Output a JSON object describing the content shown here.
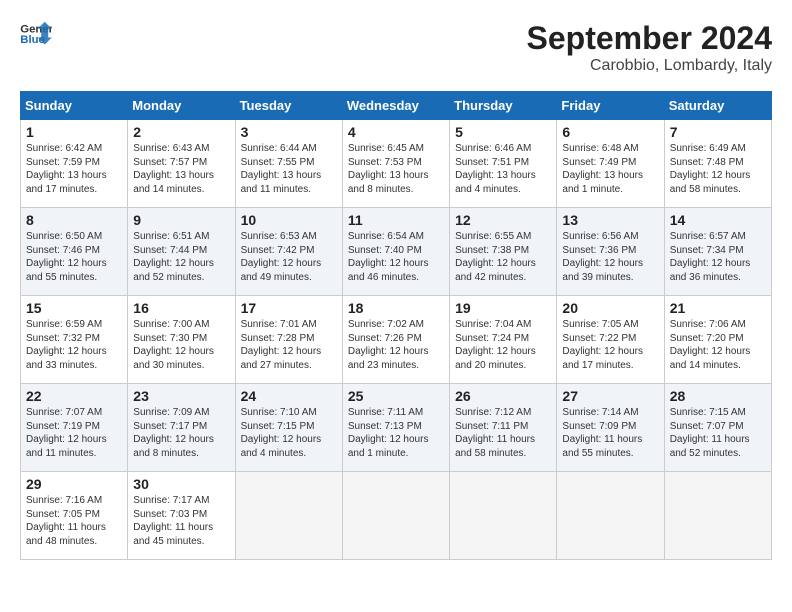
{
  "header": {
    "logo_line1": "General",
    "logo_line2": "Blue",
    "month_year": "September 2024",
    "location": "Carobbio, Lombardy, Italy"
  },
  "weekdays": [
    "Sunday",
    "Monday",
    "Tuesday",
    "Wednesday",
    "Thursday",
    "Friday",
    "Saturday"
  ],
  "weeks": [
    [
      {
        "day": "1",
        "text": "Sunrise: 6:42 AM\nSunset: 7:59 PM\nDaylight: 13 hours\nand 17 minutes."
      },
      {
        "day": "2",
        "text": "Sunrise: 6:43 AM\nSunset: 7:57 PM\nDaylight: 13 hours\nand 14 minutes."
      },
      {
        "day": "3",
        "text": "Sunrise: 6:44 AM\nSunset: 7:55 PM\nDaylight: 13 hours\nand 11 minutes."
      },
      {
        "day": "4",
        "text": "Sunrise: 6:45 AM\nSunset: 7:53 PM\nDaylight: 13 hours\nand 8 minutes."
      },
      {
        "day": "5",
        "text": "Sunrise: 6:46 AM\nSunset: 7:51 PM\nDaylight: 13 hours\nand 4 minutes."
      },
      {
        "day": "6",
        "text": "Sunrise: 6:48 AM\nSunset: 7:49 PM\nDaylight: 13 hours\nand 1 minute."
      },
      {
        "day": "7",
        "text": "Sunrise: 6:49 AM\nSunset: 7:48 PM\nDaylight: 12 hours\nand 58 minutes."
      }
    ],
    [
      {
        "day": "8",
        "text": "Sunrise: 6:50 AM\nSunset: 7:46 PM\nDaylight: 12 hours\nand 55 minutes."
      },
      {
        "day": "9",
        "text": "Sunrise: 6:51 AM\nSunset: 7:44 PM\nDaylight: 12 hours\nand 52 minutes."
      },
      {
        "day": "10",
        "text": "Sunrise: 6:53 AM\nSunset: 7:42 PM\nDaylight: 12 hours\nand 49 minutes."
      },
      {
        "day": "11",
        "text": "Sunrise: 6:54 AM\nSunset: 7:40 PM\nDaylight: 12 hours\nand 46 minutes."
      },
      {
        "day": "12",
        "text": "Sunrise: 6:55 AM\nSunset: 7:38 PM\nDaylight: 12 hours\nand 42 minutes."
      },
      {
        "day": "13",
        "text": "Sunrise: 6:56 AM\nSunset: 7:36 PM\nDaylight: 12 hours\nand 39 minutes."
      },
      {
        "day": "14",
        "text": "Sunrise: 6:57 AM\nSunset: 7:34 PM\nDaylight: 12 hours\nand 36 minutes."
      }
    ],
    [
      {
        "day": "15",
        "text": "Sunrise: 6:59 AM\nSunset: 7:32 PM\nDaylight: 12 hours\nand 33 minutes."
      },
      {
        "day": "16",
        "text": "Sunrise: 7:00 AM\nSunset: 7:30 PM\nDaylight: 12 hours\nand 30 minutes."
      },
      {
        "day": "17",
        "text": "Sunrise: 7:01 AM\nSunset: 7:28 PM\nDaylight: 12 hours\nand 27 minutes."
      },
      {
        "day": "18",
        "text": "Sunrise: 7:02 AM\nSunset: 7:26 PM\nDaylight: 12 hours\nand 23 minutes."
      },
      {
        "day": "19",
        "text": "Sunrise: 7:04 AM\nSunset: 7:24 PM\nDaylight: 12 hours\nand 20 minutes."
      },
      {
        "day": "20",
        "text": "Sunrise: 7:05 AM\nSunset: 7:22 PM\nDaylight: 12 hours\nand 17 minutes."
      },
      {
        "day": "21",
        "text": "Sunrise: 7:06 AM\nSunset: 7:20 PM\nDaylight: 12 hours\nand 14 minutes."
      }
    ],
    [
      {
        "day": "22",
        "text": "Sunrise: 7:07 AM\nSunset: 7:19 PM\nDaylight: 12 hours\nand 11 minutes."
      },
      {
        "day": "23",
        "text": "Sunrise: 7:09 AM\nSunset: 7:17 PM\nDaylight: 12 hours\nand 8 minutes."
      },
      {
        "day": "24",
        "text": "Sunrise: 7:10 AM\nSunset: 7:15 PM\nDaylight: 12 hours\nand 4 minutes."
      },
      {
        "day": "25",
        "text": "Sunrise: 7:11 AM\nSunset: 7:13 PM\nDaylight: 12 hours\nand 1 minute."
      },
      {
        "day": "26",
        "text": "Sunrise: 7:12 AM\nSunset: 7:11 PM\nDaylight: 11 hours\nand 58 minutes."
      },
      {
        "day": "27",
        "text": "Sunrise: 7:14 AM\nSunset: 7:09 PM\nDaylight: 11 hours\nand 55 minutes."
      },
      {
        "day": "28",
        "text": "Sunrise: 7:15 AM\nSunset: 7:07 PM\nDaylight: 11 hours\nand 52 minutes."
      }
    ],
    [
      {
        "day": "29",
        "text": "Sunrise: 7:16 AM\nSunset: 7:05 PM\nDaylight: 11 hours\nand 48 minutes."
      },
      {
        "day": "30",
        "text": "Sunrise: 7:17 AM\nSunset: 7:03 PM\nDaylight: 11 hours\nand 45 minutes."
      },
      {
        "day": "",
        "text": ""
      },
      {
        "day": "",
        "text": ""
      },
      {
        "day": "",
        "text": ""
      },
      {
        "day": "",
        "text": ""
      },
      {
        "day": "",
        "text": ""
      }
    ]
  ]
}
